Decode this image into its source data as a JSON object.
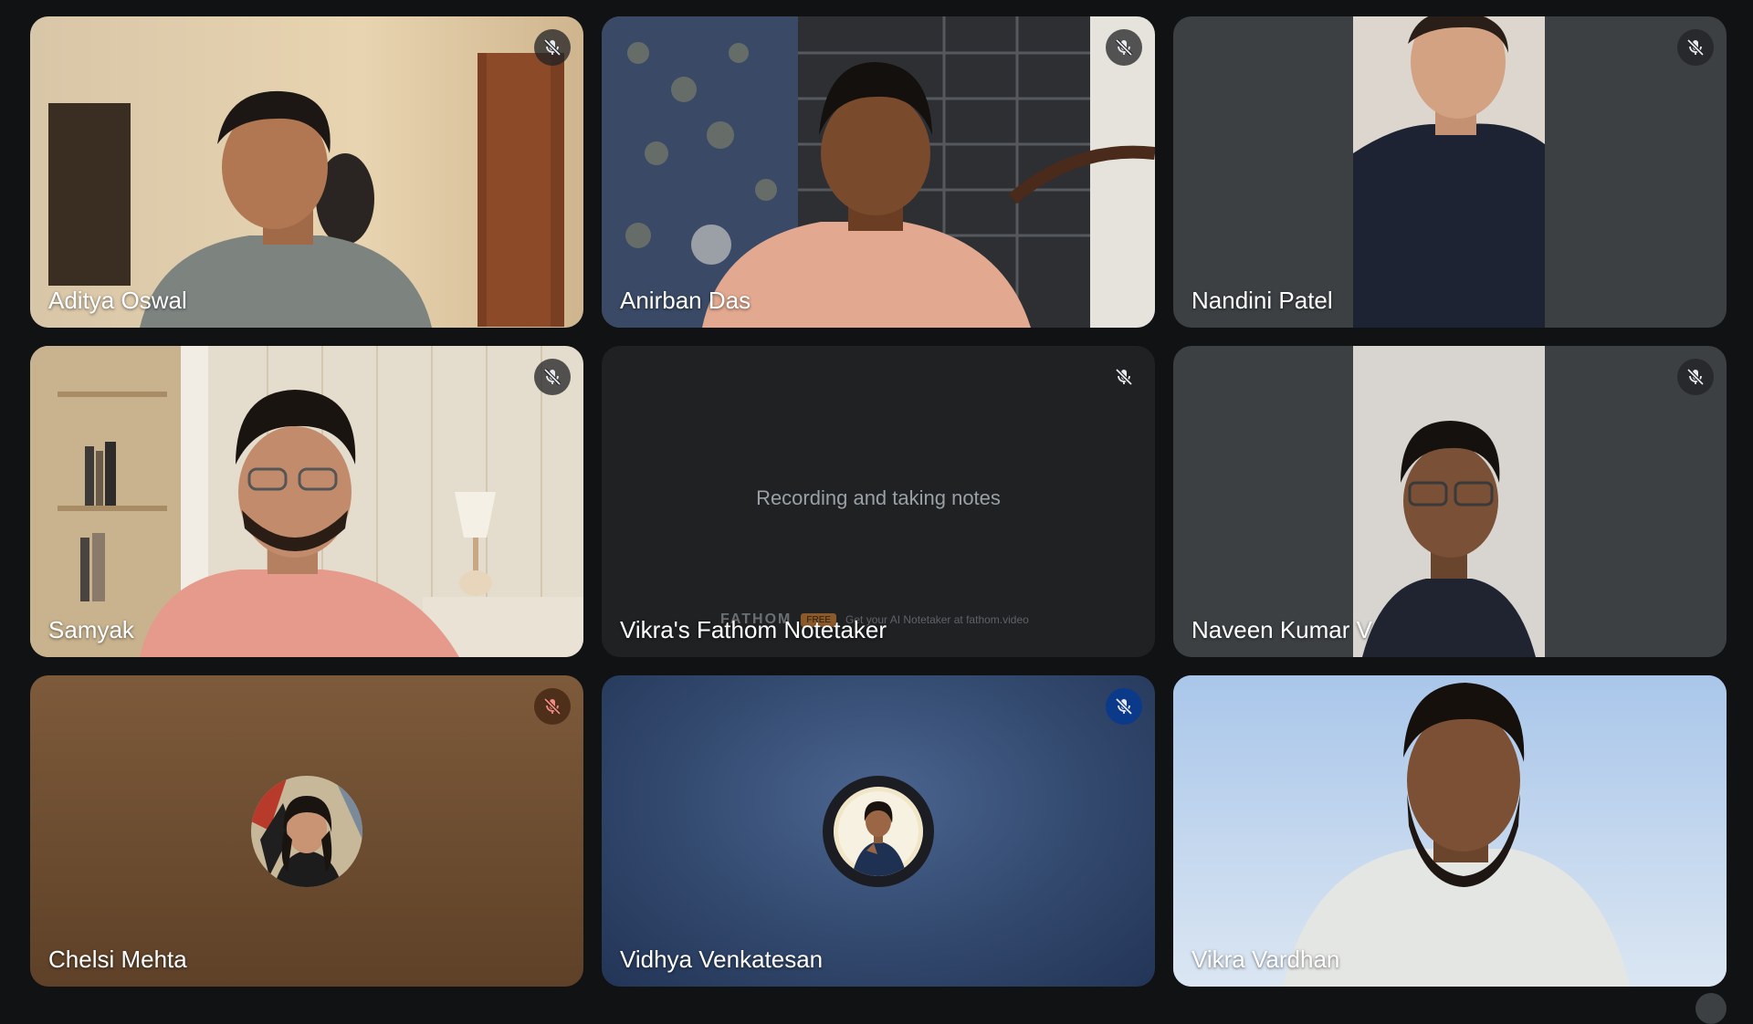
{
  "participants": [
    {
      "name": "Aditya Oswal",
      "muted": true
    },
    {
      "name": "Anirban Das",
      "muted": true
    },
    {
      "name": "Nandini Patel",
      "muted": true
    },
    {
      "name": "Samyak",
      "muted": true
    },
    {
      "name": "Vikra's Fathom Notetaker",
      "muted": true,
      "status_text": "Recording and taking notes",
      "banner_brand": "FATHOM",
      "banner_tag": "FREE",
      "banner_text": "Get your AI Notetaker at fathom.video"
    },
    {
      "name": "Naveen Kumar V",
      "muted": true
    },
    {
      "name": "Chelsi Mehta",
      "muted": true
    },
    {
      "name": "Vidhya Venkatesan",
      "muted": true
    },
    {
      "name": "Vikra Vardhan",
      "muted": false,
      "speaking": true
    }
  ],
  "icons": {
    "mic_off": "mic-off-icon"
  },
  "colors": {
    "background": "#111214",
    "tile": "#3c4043",
    "speaking_outline": "#a8c7fa",
    "mic_blue": "#0b3a8a"
  }
}
